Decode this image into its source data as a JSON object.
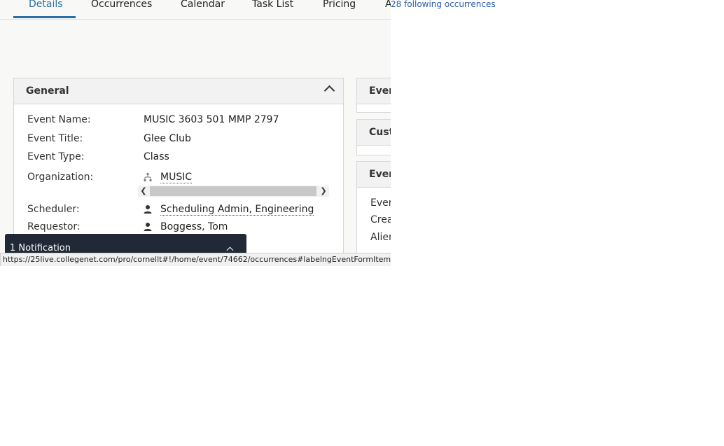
{
  "tabs": [
    {
      "label": "Details",
      "active": true
    },
    {
      "label": "Occurrences"
    },
    {
      "label": "Calendar"
    },
    {
      "label": "Task List"
    },
    {
      "label": "Pricing"
    },
    {
      "label": "A"
    }
  ],
  "floating_link": "28 following occurrences",
  "general": {
    "title": "General",
    "fields": [
      {
        "label": "Event Name:",
        "value": "MUSIC 3603 501 MMP 2797"
      },
      {
        "label": "Event Title:",
        "value": "Glee Club"
      },
      {
        "label": "Event Type:",
        "value": "Class"
      },
      {
        "label": "Organization:",
        "value": "MUSIC",
        "icon": "org-chart-icon"
      },
      {
        "label": "Scheduler:",
        "value": "Scheduling Admin, Engineering",
        "icon": "person-icon"
      },
      {
        "label": "Requestor:",
        "value": "Boggess, Tom",
        "icon": "person-icon"
      }
    ]
  },
  "right_panels": [
    {
      "title": "Ever"
    },
    {
      "title": "Cust"
    },
    {
      "title": "Ever",
      "rows": [
        "Ever",
        "Crea",
        "Alier"
      ]
    }
  ],
  "notification": {
    "text": "1 Notification"
  },
  "status_url": "https://25live.collegenet.com/pro/cornellt#!/home/event/74662/occurrences#labelngEventFormItem-10",
  "colors": {
    "accent": "#2a6fa5",
    "notification_bg": "#212836",
    "link": "#2a5da8"
  }
}
